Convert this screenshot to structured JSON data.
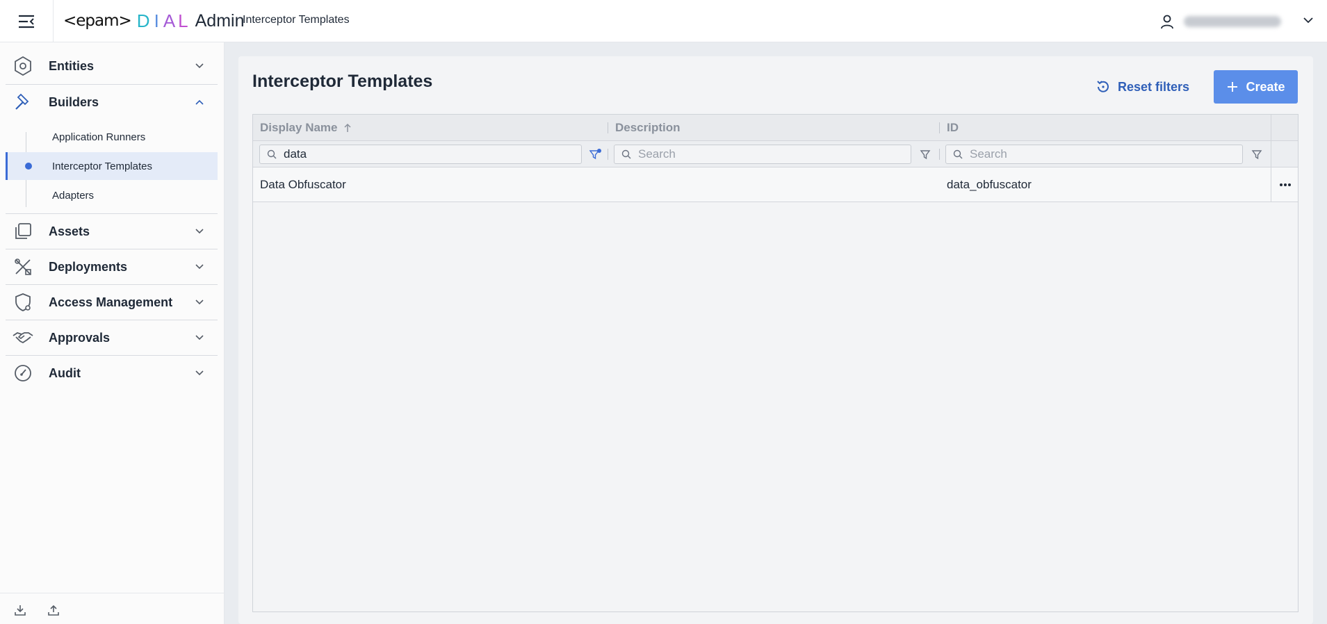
{
  "header": {
    "logo_epam": "<epam>",
    "logo_d": "D",
    "logo_i": "I",
    "logo_a": "A",
    "logo_l": "L",
    "logo_admin": "Admin",
    "breadcrumb": "Interceptor Templates"
  },
  "sidebar": {
    "groups": {
      "entities": "Entities",
      "builders": "Builders",
      "assets": "Assets",
      "deployments": "Deployments",
      "access": "Access Management",
      "approvals": "Approvals",
      "audit": "Audit"
    },
    "builders_items": {
      "runners": "Application Runners",
      "interceptors": "Interceptor Templates",
      "adapters": "Adapters"
    }
  },
  "main": {
    "title": "Interceptor Templates",
    "reset_label": "Reset filters",
    "create_label": "Create"
  },
  "grid": {
    "columns": {
      "display_name": "Display Name",
      "description": "Description",
      "id": "ID"
    },
    "filters": {
      "display_name_value": "data",
      "description_placeholder": "Search",
      "id_placeholder": "Search"
    },
    "rows": [
      {
        "display_name": "Data Obfuscator",
        "description": "",
        "id": "data_obfuscator"
      }
    ]
  },
  "colors": {
    "accent": "#3a6bd6",
    "create_button": "#5b8ee9",
    "link": "#2f5fb8"
  }
}
